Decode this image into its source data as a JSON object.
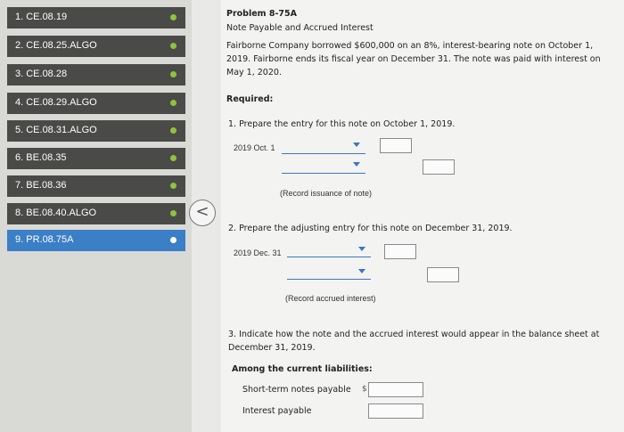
{
  "nav": {
    "items": [
      {
        "label": "1. CE.08.19"
      },
      {
        "label": "2. CE.08.25.ALGO"
      },
      {
        "label": "3. CE.08.28"
      },
      {
        "label": "4. CE.08.29.ALGO"
      },
      {
        "label": "5. CE.08.31.ALGO"
      },
      {
        "label": "6. BE.08.35"
      },
      {
        "label": "7. BE.08.36"
      },
      {
        "label": "8. BE.08.40.ALGO"
      },
      {
        "label": "9. PR.08.75A"
      }
    ],
    "collapse_icon": "<"
  },
  "problem": {
    "title": "Problem 8-75A",
    "subtitle": "Note Payable and Accrued Interest",
    "description": "Fairborne Company borrowed $600,000 on an 8%, interest-bearing note on October 1, 2019. Fairborne ends its fiscal year on December 31. The note was paid with interest on May 1, 2020.",
    "required": "Required:",
    "q1": "1.  Prepare the entry for this note on October 1, 2019.",
    "q1_date": "2019 Oct. 1",
    "q1_note": "(Record issuance of note)",
    "q2": "2.  Prepare the adjusting entry for this note on December 31, 2019.",
    "q2_date": "2019 Dec. 31",
    "q2_note": "(Record accrued interest)",
    "q3": "3.  Indicate how the note and the accrued interest would appear in the balance sheet at December 31, 2019.",
    "current_liabilities_heading": "Among the current liabilities:",
    "row1_label": "Short-term notes payable",
    "row1_currency": "$",
    "row2_label": "Interest payable"
  },
  "colors": {
    "nav_item": "#4a4a48",
    "nav_active": "#3b7fc6",
    "status_dot": "#8fc33a",
    "dropdown_accent": "#3a78c0"
  }
}
